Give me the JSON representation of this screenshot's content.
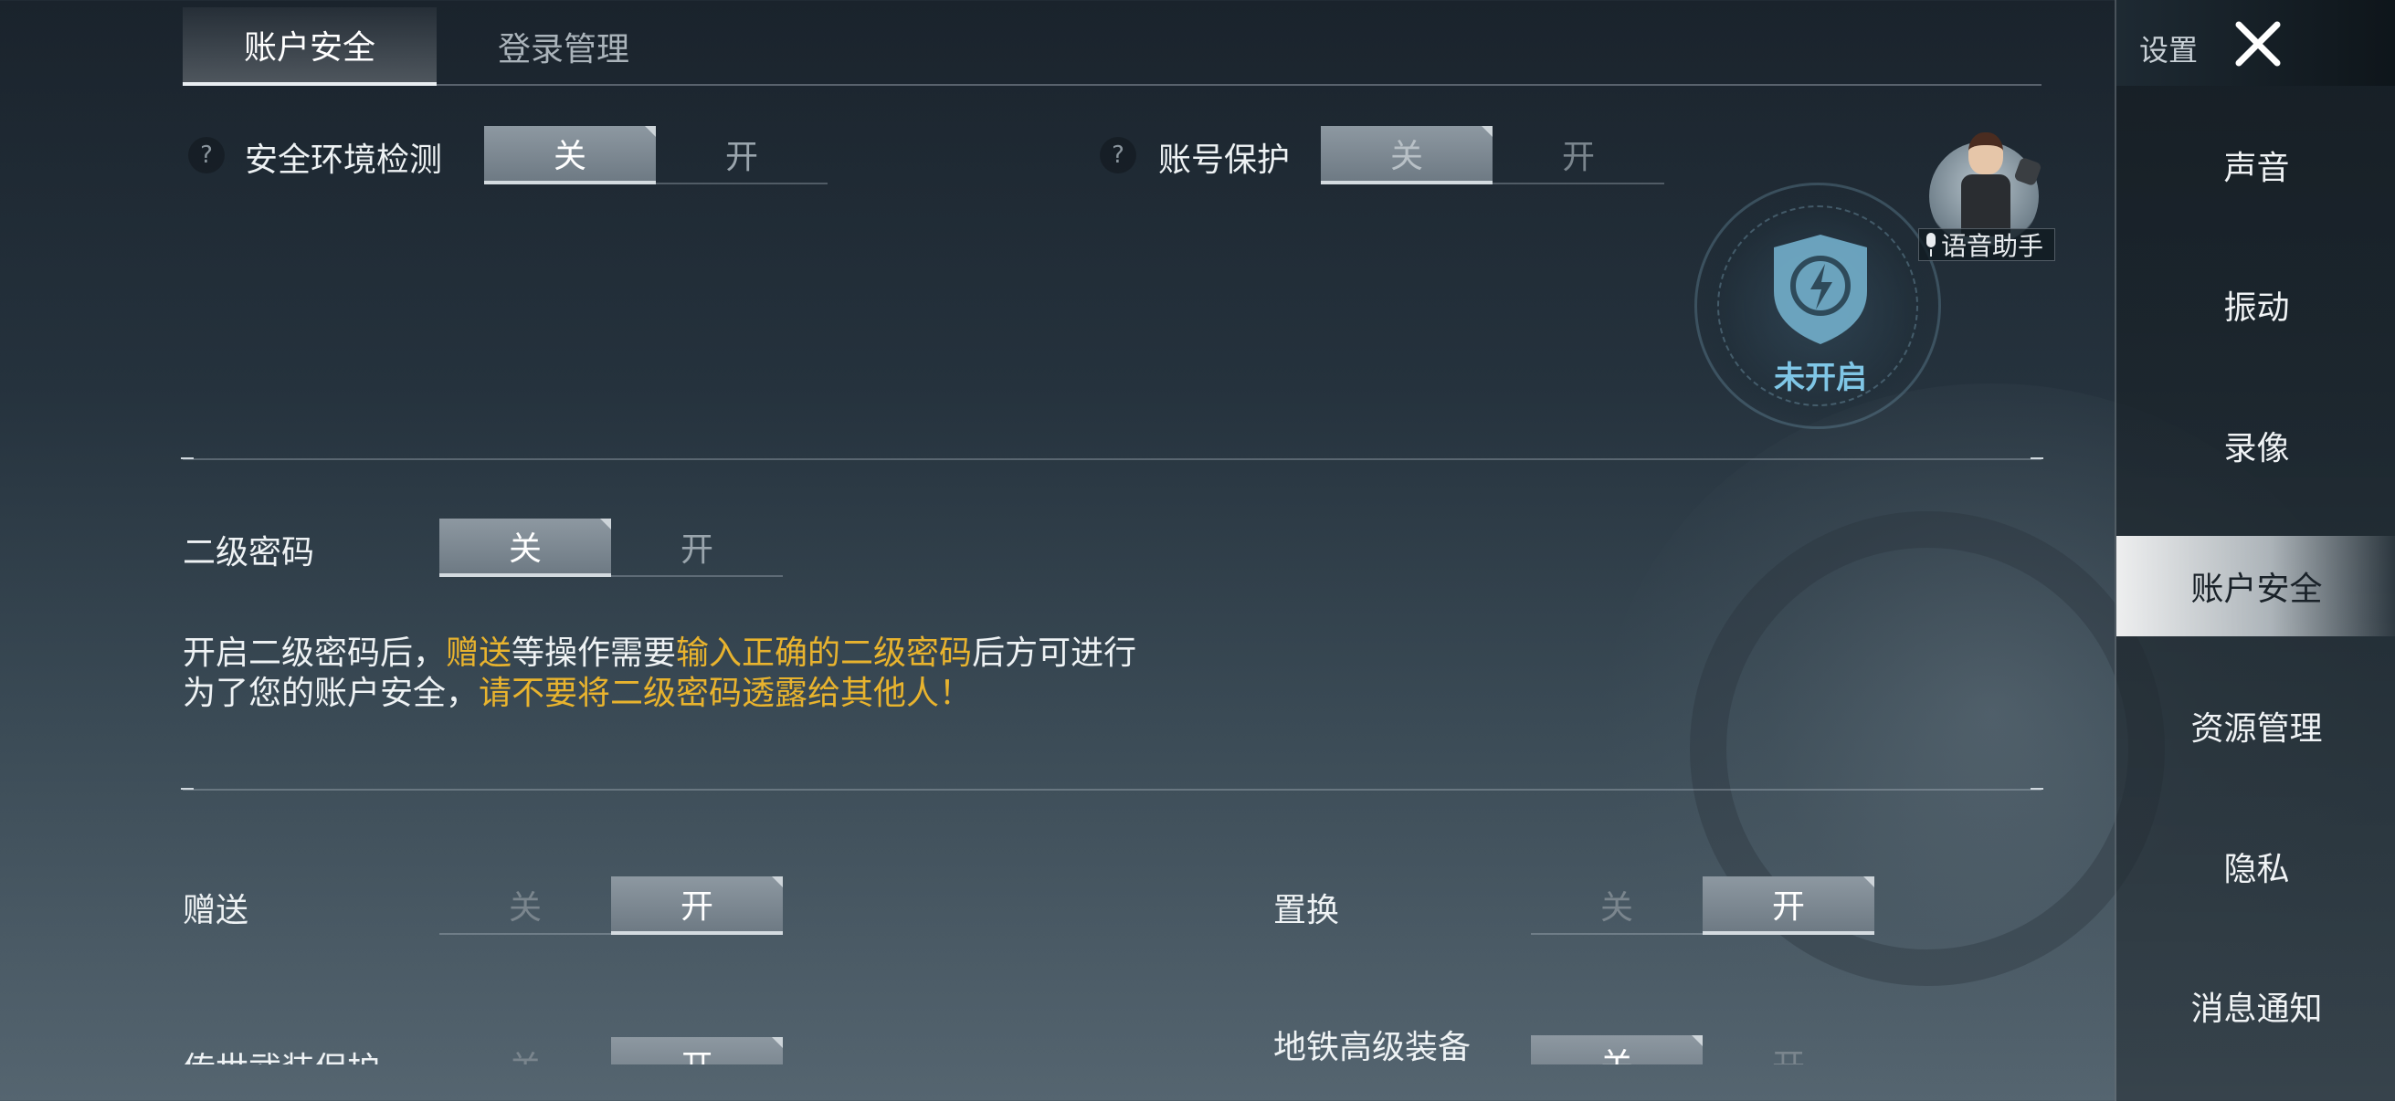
{
  "tabs": [
    {
      "label": "账户安全",
      "active": true
    },
    {
      "label": "登录管理",
      "active": false
    }
  ],
  "security_env": {
    "label": "安全环境检测",
    "help": "?",
    "off": "关",
    "on": "开",
    "state": "off"
  },
  "account_protect": {
    "label": "账号保护",
    "help": "?",
    "off": "关",
    "on": "开",
    "state": "off"
  },
  "shield": {
    "status": "未开启",
    "icon": "shield-lightning-icon"
  },
  "voice_assistant": {
    "label": "语音助手",
    "icon": "microphone-icon"
  },
  "second_password": {
    "label": "二级密码",
    "off": "关",
    "on": "开",
    "state": "off"
  },
  "info": {
    "line1": {
      "p1": "开启二级密码后，",
      "h1": "赠送",
      "p2": "等操作需要",
      "h2": "输入正确的二级密码",
      "p3": "后方可进行"
    },
    "line2": {
      "p1": "为了您的账户安全，",
      "h1": "请不要将二级密码透露给其他人！"
    }
  },
  "gift": {
    "label": "赠送",
    "off": "关",
    "on": "开",
    "state": "on"
  },
  "replace": {
    "label": "置换",
    "off": "关",
    "on": "开",
    "state": "on"
  },
  "legend_armor": {
    "label": "传世武装保护",
    "off": "关",
    "on": "开",
    "state": "on"
  },
  "metro_gear": {
    "label": "地铁高级装备",
    "off": "关",
    "on": "开",
    "state": "off"
  },
  "sidebar": {
    "title": "设置",
    "close_icon": "close-icon",
    "items": [
      {
        "label": "声音",
        "active": false
      },
      {
        "label": "振动",
        "active": false
      },
      {
        "label": "录像",
        "active": false
      },
      {
        "label": "账户安全",
        "active": true
      },
      {
        "label": "资源管理",
        "active": false
      },
      {
        "label": "隐私",
        "active": false
      },
      {
        "label": "消息通知",
        "active": false
      }
    ]
  },
  "colors": {
    "highlight": "#e8b32e",
    "shield_text": "#7fc6e6",
    "selected_toggle": "#7f8a93"
  }
}
